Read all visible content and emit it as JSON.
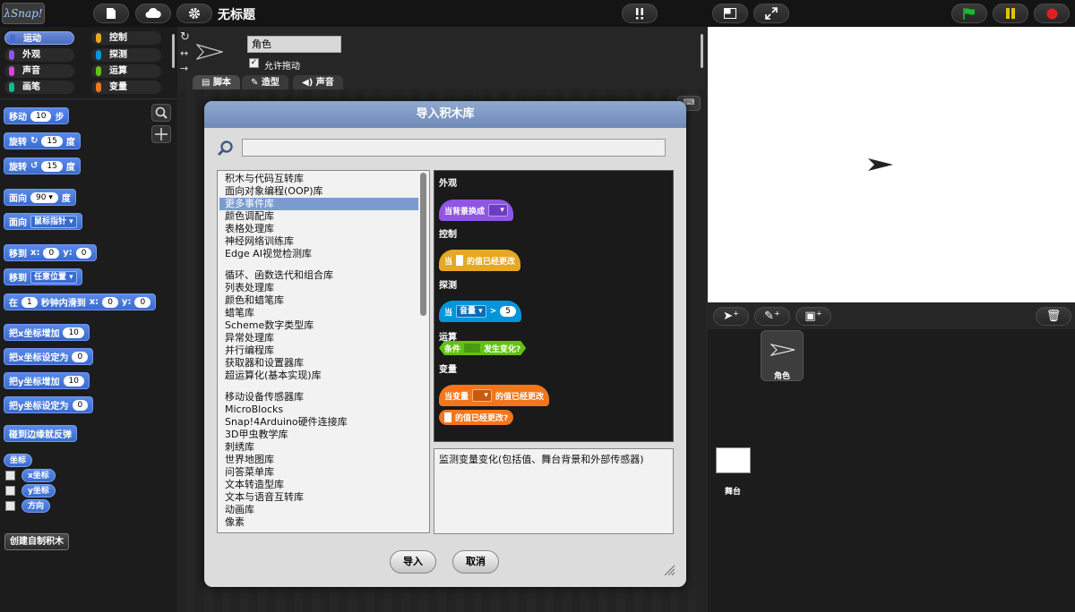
{
  "app": {
    "logo": "λSnap!",
    "project_title": "无标题"
  },
  "colors": {
    "motion": "#4a6cd4",
    "looks": "#8f56e3",
    "sound": "#cf4ad9",
    "pen": "#0fbd8c",
    "control": "#e6a822",
    "sensing": "#0494dc",
    "operators": "#62c213",
    "variables": "#f3761d",
    "green_flag": "#1db82e",
    "pause": "#e6c200",
    "stop": "#e02020"
  },
  "palette": {
    "categories": [
      {
        "label": "运动"
      },
      {
        "label": "控制"
      },
      {
        "label": "外观"
      },
      {
        "label": "探测"
      },
      {
        "label": "声音"
      },
      {
        "label": "运算"
      },
      {
        "label": "画笔"
      },
      {
        "label": "变量"
      }
    ],
    "blocks": {
      "move_label": "移动",
      "move_value": "10",
      "move_unit": "步",
      "turn_cw_label": "旋转",
      "turn_cw_value": "15",
      "turn_cw_unit": "度",
      "turn_ccw_label": "旋转",
      "turn_ccw_value": "15",
      "turn_ccw_unit": "度",
      "point_label": "面向",
      "point_value": "90",
      "point_unit": "度",
      "point_towards_label": "面向",
      "point_towards_value": "鼠标指针",
      "goto_xy_label": "移到",
      "goto_x_label": "x:",
      "goto_x": "0",
      "goto_y_label": "y:",
      "goto_y": "0",
      "goto_label": "移到",
      "goto_value": "任意位置",
      "glide_label": "在",
      "glide_secs": "1",
      "glide_mid": "秒钟内滑到",
      "glide_x_label": "x:",
      "glide_x": "0",
      "glide_y_label": "y:",
      "glide_y": "0",
      "change_x_label": "把x坐标增加",
      "change_x_value": "10",
      "set_x_label": "把x坐标设定为",
      "set_x_value": "0",
      "change_y_label": "把y坐标增加",
      "change_y_value": "10",
      "set_y_label": "把y坐标设定为",
      "set_y_value": "0",
      "bounce_label": "碰到边缘就反弹",
      "position_label": "坐标",
      "xpos_label": "x坐标",
      "ypos_label": "y坐标",
      "direction_label": "方向"
    },
    "make_block_label": "创建自制积木"
  },
  "spritebar": {
    "sprite_name": "角色",
    "draggable_label": "允许拖动",
    "tabs": [
      {
        "label": "脚本"
      },
      {
        "label": "造型"
      },
      {
        "label": "声音"
      }
    ]
  },
  "dialog": {
    "title": "导入积木库",
    "search_value": "",
    "libraries": [
      "积木与代码互转库",
      "面向对象编程(OOP)库",
      "更多事件库",
      "颜色调配库",
      "表格处理库",
      "神经网络训练库",
      "Edge AI视觉检测库",
      "循环、函数迭代和组合库",
      "列表处理库",
      "颜色和蜡笔库",
      "蜡笔库",
      "Scheme数字类型库",
      "异常处理库",
      "并行编程库",
      "获取器和设置器库",
      "超运算化(基本实现)库",
      "移动设备传感器库",
      "MicroBlocks",
      "Snap!4Arduino硬件连接库",
      "3D甲虫教学库",
      "刺绣库",
      "世界地图库",
      "问答菜单库",
      "文本转造型库",
      "文本与语音互转库",
      "动画库",
      "像素"
    ],
    "selected_library": "更多事件库",
    "preview": {
      "looks_label": "外观",
      "looks_block": "当背景换成",
      "control_label": "控制",
      "control_block_pre": "当",
      "control_block_post": "的值已经更改",
      "sensing_label": "探测",
      "sensing_block_pre": "当",
      "sensing_block_dd": "音量",
      "sensing_block_op": ">",
      "sensing_block_val": "5",
      "operators_label": "运算",
      "operators_block_pre": "条件",
      "operators_block_post": "发生变化?",
      "variables_label": "变量",
      "variables_block_pre": "当变量",
      "variables_block_post": "的值已经更改",
      "variables_reporter": "的值已经更改?"
    },
    "description": "监测变量变化(包括值、舞台背景和外部传感器)",
    "import_label": "导入",
    "cancel_label": "取消"
  },
  "corral": {
    "sprite_label": "角色",
    "stage_label": "舞台"
  }
}
